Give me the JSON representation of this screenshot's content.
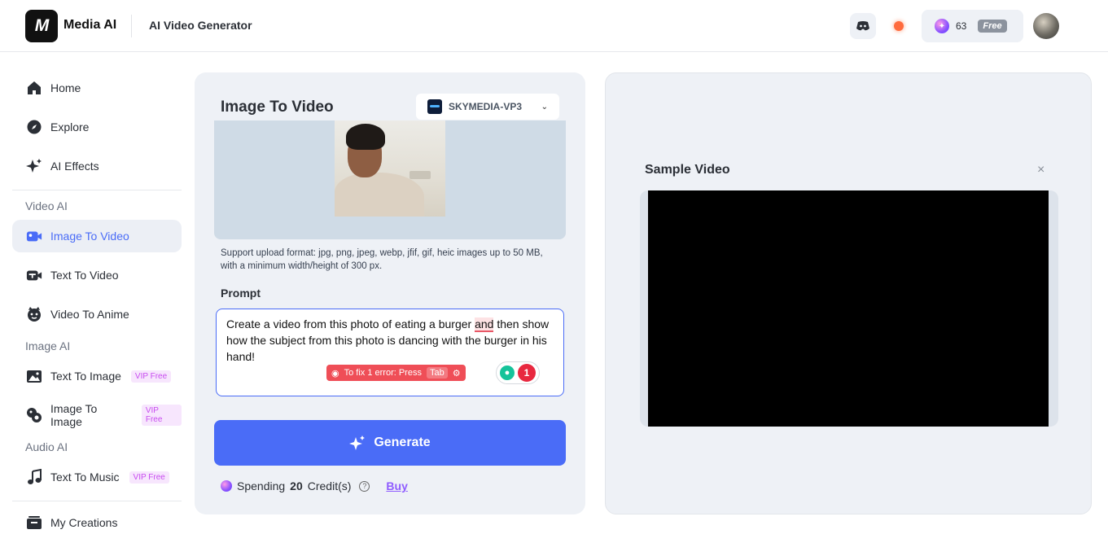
{
  "header": {
    "logo_text": "M",
    "brand": "Media AI",
    "app_title": "AI Video Generator",
    "credits": "63",
    "plan": "Free",
    "icons": [
      "discord-icon",
      "record-dot-icon",
      "credit-gem-icon",
      "avatar"
    ]
  },
  "sidebar": {
    "items": [
      {
        "label": "Home",
        "icon": "home-icon"
      },
      {
        "label": "Explore",
        "icon": "compass-icon"
      },
      {
        "label": "AI Effects",
        "icon": "sparkle-icon"
      }
    ],
    "sections": [
      {
        "title": "Video AI",
        "items": [
          {
            "label": "Image To Video",
            "active": true
          },
          {
            "label": "Text To Video"
          },
          {
            "label": "Video To Anime"
          }
        ]
      },
      {
        "title": "Image AI",
        "items": [
          {
            "label": "Text To Image",
            "badge": "VIP Free"
          },
          {
            "label": "Image To Image",
            "badge": "VIP Free"
          }
        ]
      },
      {
        "title": "Audio AI",
        "items": [
          {
            "label": "Text To Music",
            "badge": "VIP Free"
          }
        ]
      }
    ],
    "bottom": {
      "label": "My Creations"
    }
  },
  "main": {
    "title": "Image To Video",
    "model": "SKYMEDIA-VP3",
    "support_text": "Support upload format: jpg, png, jpeg, webp, jfif, gif, heic images up to 50 MB, with a minimum width/height of 300 px.",
    "prompt_label": "Prompt",
    "prompt_before": "Create a video from this photo of eating a burger ",
    "prompt_error_word": "and",
    "prompt_after": " then show how the subject from this photo is dancing with the burger in his hand!",
    "grammar_tip": "To fix 1 error: Press",
    "grammar_key": "Tab",
    "grammar_count": "1",
    "generate_label": "Generate",
    "spending_prefix": "Spending",
    "spending_amount": "20",
    "spending_suffix": "Credit(s)",
    "buy_label": "Buy"
  },
  "sample": {
    "title": "Sample Video",
    "close": "×"
  },
  "colors": {
    "accent": "#4a6cf7",
    "panel_bg": "#eef1f6",
    "vip": "#c84cf0",
    "error": "#ef4e57"
  }
}
